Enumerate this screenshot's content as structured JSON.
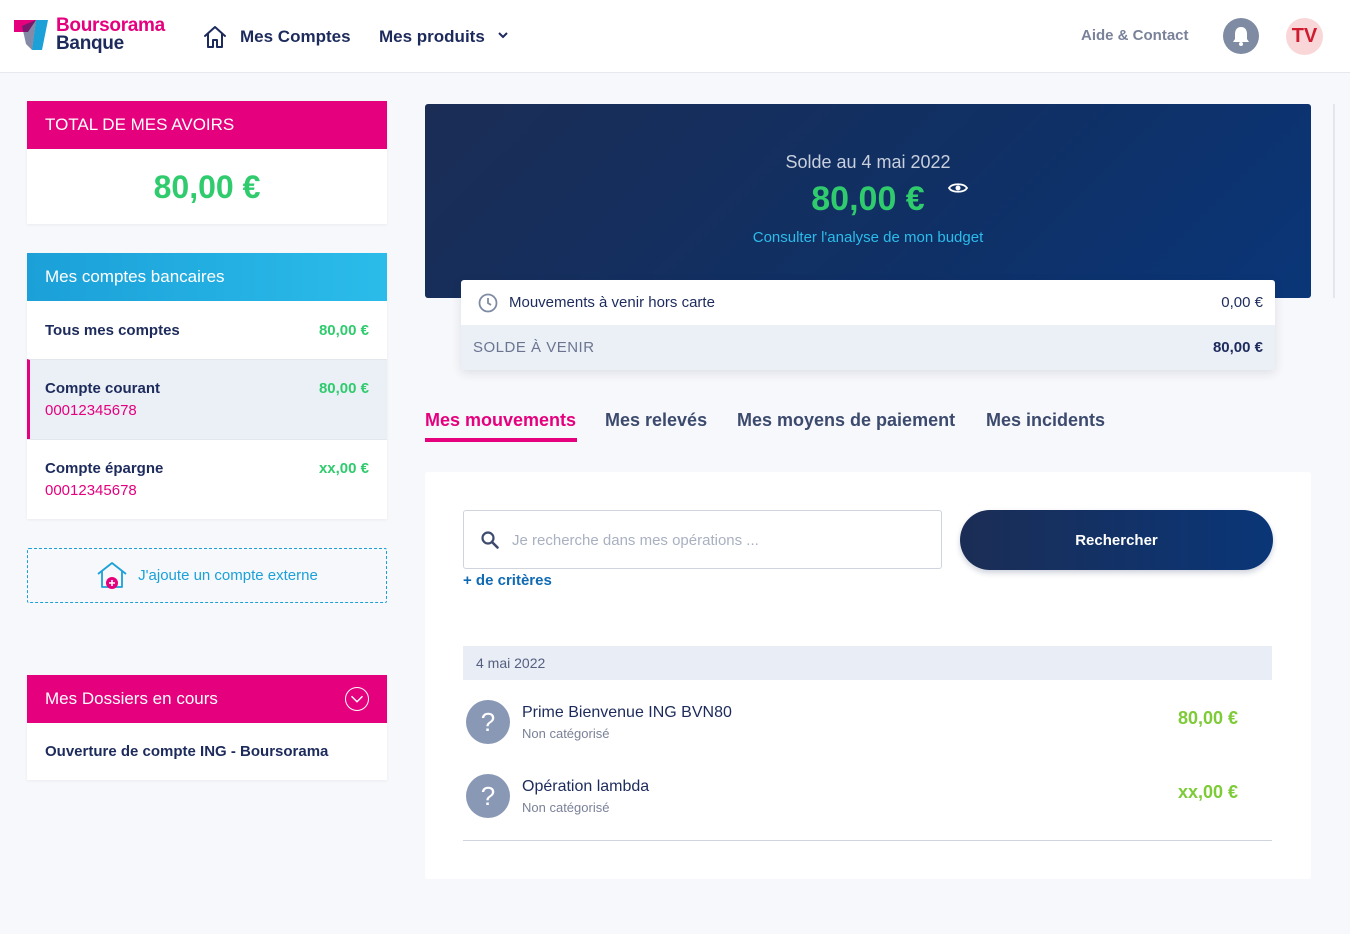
{
  "brand": {
    "line1": "Boursorama",
    "line2": "Banque"
  },
  "nav": {
    "accounts": "Mes Comptes",
    "products": "Mes produits",
    "help": "Aide & Contact",
    "avatar_initials": "TV"
  },
  "total": {
    "title": "TOTAL DE MES AVOIRS",
    "amount": "80,00 €"
  },
  "bank_accounts": {
    "title": "Mes comptes bancaires",
    "items": [
      {
        "name": "Tous mes comptes",
        "number": "",
        "amount": "80,00 €"
      },
      {
        "name": "Compte courant",
        "number": "00012345678",
        "amount": "80,00 €"
      },
      {
        "name": "Compte épargne",
        "number": "00012345678",
        "amount": "xx,00 €"
      }
    ]
  },
  "external_account": {
    "label": "J'ajoute un compte externe"
  },
  "dossiers": {
    "title": "Mes Dossiers en cours",
    "item": "Ouverture de compte ING - Boursorama"
  },
  "balance": {
    "date_label": "Solde au 4 mai 2022",
    "amount": "80,00 €",
    "budget_link": "Consulter l'analyse de mon budget"
  },
  "upcoming": {
    "label": "Mouvements à venir hors carte",
    "value": "0,00 €",
    "balance_label": "SOLDE À VENIR",
    "balance_value": "80,00 €"
  },
  "tabs": [
    "Mes mouvements",
    "Mes relevés",
    "Mes moyens de paiement",
    "Mes incidents"
  ],
  "search": {
    "placeholder": "Je recherche dans mes opérations ...",
    "button": "Rechercher",
    "criteria": "+ de critères"
  },
  "operations": {
    "date": "4 mai 2022",
    "items": [
      {
        "icon": "?",
        "name": "Prime Bienvenue ING BVN80",
        "category": "Non catégorisé",
        "amount": "80,00 €"
      },
      {
        "icon": "?",
        "name": "Opération lambda",
        "category": "Non catégorisé",
        "amount": "xx,00 €"
      }
    ]
  },
  "colors": {
    "brand_pink": "#e5007e",
    "brand_blue": "#1ba0d8",
    "navy": "#1d2b5c",
    "positive_green": "#2fcb6d",
    "operation_green": "#7ecb38"
  }
}
